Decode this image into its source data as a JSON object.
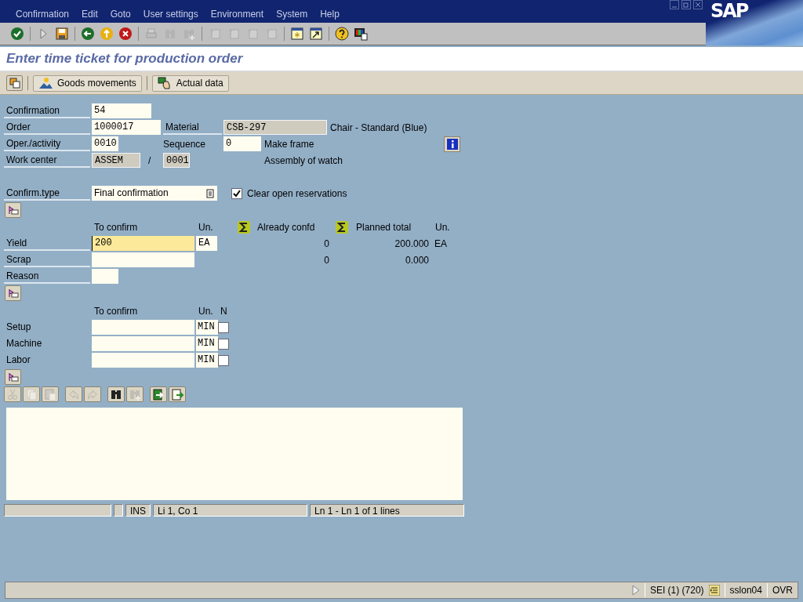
{
  "menu": [
    "Confirmation",
    "Edit",
    "Goto",
    "User settings",
    "Environment",
    "System",
    "Help"
  ],
  "logo": "SAP",
  "toolbar": [
    [
      {
        "kind": "check",
        "disabled": false
      }
    ],
    [
      {
        "kind": "command",
        "disabled": false
      },
      {
        "kind": "save",
        "disabled": false
      }
    ],
    [
      {
        "kind": "back",
        "disabled": false
      },
      {
        "kind": "exit",
        "disabled": false
      },
      {
        "kind": "cancel",
        "disabled": false
      }
    ],
    [
      {
        "kind": "print",
        "disabled": true
      },
      {
        "kind": "find",
        "disabled": true
      },
      {
        "kind": "find_next",
        "disabled": true
      }
    ],
    [
      {
        "kind": "first_page",
        "disabled": true
      },
      {
        "kind": "prev_page",
        "disabled": true
      },
      {
        "kind": "next_page",
        "disabled": true
      },
      {
        "kind": "last_page",
        "disabled": true
      }
    ],
    [
      {
        "kind": "new_session",
        "disabled": false
      },
      {
        "kind": "shortcut",
        "disabled": false
      }
    ],
    [
      {
        "kind": "help",
        "disabled": false
      },
      {
        "kind": "layout",
        "disabled": false
      }
    ]
  ],
  "title": "Enter time ticket for production order",
  "app_toolbar": [
    {
      "kind": "icon"
    },
    {
      "kind": "goods",
      "label": "Goods movements"
    },
    {
      "kind": "actual",
      "label": "Actual data"
    }
  ],
  "header": {
    "confirmation": {
      "label": "Confirmation",
      "value": "54",
      "readonly": false
    },
    "order": {
      "label": "Order",
      "value": "1000017",
      "readonly": false
    },
    "material": {
      "label": "Material",
      "value": "CSB-297",
      "readonly": true,
      "description": "Chair - Standard (Blue)"
    },
    "operation": {
      "label": "Oper./activity",
      "value": "0010",
      "readonly": false
    },
    "sequence": {
      "label": "Sequence",
      "value": "0",
      "readonly": false,
      "description": "Make frame"
    },
    "work_center": {
      "label": "Work center",
      "value": "ASSEM",
      "readonly": true,
      "separator": "/",
      "plant": "0001",
      "plant_readonly": true,
      "description": "Assembly of watch"
    }
  },
  "confirm_type": {
    "label": "Confirm.type",
    "value": "Final confirmation"
  },
  "clear_reservations": {
    "label": "Clear open reservations",
    "checked": true
  },
  "quantities": {
    "columns": {
      "to_confirm": "To confirm",
      "unit": "Un.",
      "already": "Already confd",
      "planned": "Planned total",
      "planned_unit": "Un."
    },
    "rows": [
      {
        "kind": "quantity",
        "label": "Yield",
        "value": "200",
        "focused": true,
        "unit": "EA",
        "already": "0",
        "planned": "200.000",
        "planned_unit": "EA"
      },
      {
        "kind": "quantity",
        "label": "Scrap",
        "focused": false,
        "already": "0",
        "planned": "0.000"
      },
      {
        "kind": "reason",
        "label": "Reason",
        "focused": false
      }
    ]
  },
  "activities": {
    "columns": {
      "to_confirm": "To confirm",
      "unit": "Un.",
      "flag": "N"
    },
    "rows": [
      {
        "label": "Setup",
        "unit": "MIN",
        "checked": false
      },
      {
        "label": "Machine",
        "unit": "MIN",
        "checked": false
      },
      {
        "label": "Labor",
        "unit": "MIN",
        "checked": false
      }
    ]
  },
  "editor_toolbar": [
    [
      {
        "kind": "cut",
        "disabled": true
      },
      {
        "kind": "copy",
        "disabled": true
      },
      {
        "kind": "paste",
        "disabled": true
      }
    ],
    [
      {
        "kind": "undo",
        "disabled": true
      },
      {
        "kind": "redo",
        "disabled": true
      }
    ],
    [
      {
        "kind": "find",
        "disabled": false
      },
      {
        "kind": "find_next",
        "disabled": true
      }
    ],
    [
      {
        "kind": "import",
        "disabled": false
      },
      {
        "kind": "export",
        "disabled": false
      }
    ]
  ],
  "editor_status": {
    "mode": "INS",
    "cursor": "Li 1, Co 1",
    "lines": "Ln 1 - Ln 1 of 1 lines"
  },
  "status_bar": {
    "system": "SEI (1) (720)",
    "server": "sslon04",
    "mode": "OVR"
  }
}
